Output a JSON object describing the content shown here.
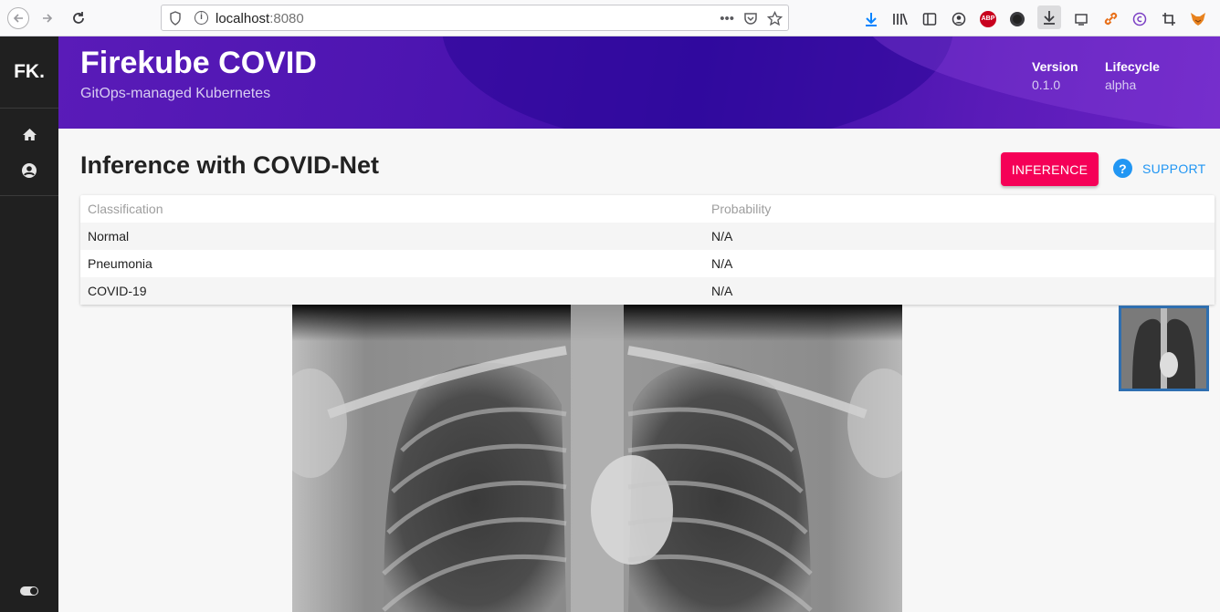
{
  "browser": {
    "url_host": "localhost",
    "url_port": ":8080",
    "page_actions": "•••",
    "abp_label": "ABP"
  },
  "sidebar": {
    "logo": "FK",
    "logo_dot": "."
  },
  "header": {
    "title": "Firekube COVID",
    "subtitle": "GitOps-managed Kubernetes",
    "version_label": "Version",
    "version_value": "0.1.0",
    "lifecycle_label": "Lifecycle",
    "lifecycle_value": "alpha"
  },
  "main": {
    "title": "Inference with COVID-Net",
    "inference_button": "INFERENCE",
    "support_link": "SUPPORT",
    "help_glyph": "?"
  },
  "table": {
    "headers": [
      "Classification",
      "Probability"
    ],
    "rows": [
      {
        "classification": "Normal",
        "probability": "N/A"
      },
      {
        "classification": "Pneumonia",
        "probability": "N/A"
      },
      {
        "classification": "COVID-19",
        "probability": "N/A"
      }
    ]
  },
  "colors": {
    "accent": "#f50057",
    "link": "#2196f3",
    "header_purple": "#4b14b0",
    "sidebar": "#202020"
  },
  "icons": [
    "back-icon",
    "forward-icon",
    "reload-icon",
    "shield-icon",
    "info-icon",
    "pocket-icon",
    "star-icon",
    "download-icon",
    "library-icon",
    "sidebar-icon",
    "account-icon",
    "adblock-icon",
    "home-icon",
    "user-icon",
    "toggle-icon",
    "help-icon"
  ]
}
